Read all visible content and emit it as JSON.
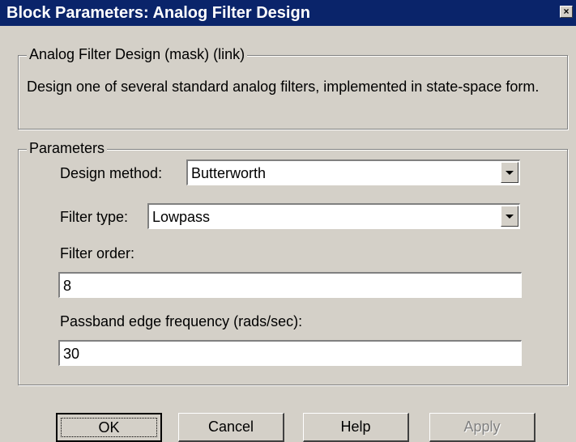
{
  "window": {
    "title": "Block Parameters: Analog Filter Design",
    "close_glyph": "×"
  },
  "mask_group": {
    "legend": "Analog Filter Design (mask) (link)",
    "description": "Design one of several standard analog filters, implemented in state-space form."
  },
  "parameters": {
    "legend": "Parameters",
    "design_method": {
      "label": "Design method:",
      "value": "Butterworth"
    },
    "filter_type": {
      "label": "Filter type:",
      "value": "Lowpass"
    },
    "filter_order": {
      "label": "Filter order:",
      "value": "8"
    },
    "passband_edge": {
      "label": "Passband edge frequency (rads/sec):",
      "value": "30"
    }
  },
  "buttons": {
    "ok": "OK",
    "cancel": "Cancel",
    "help": "Help",
    "apply": "Apply"
  },
  "colors": {
    "titlebar": "#0a246a",
    "dialog_bg": "#d4d0c8",
    "disabled_text": "#808080"
  },
  "icons": {
    "close": "close-icon",
    "dropdown": "dropdown-arrow-icon"
  }
}
